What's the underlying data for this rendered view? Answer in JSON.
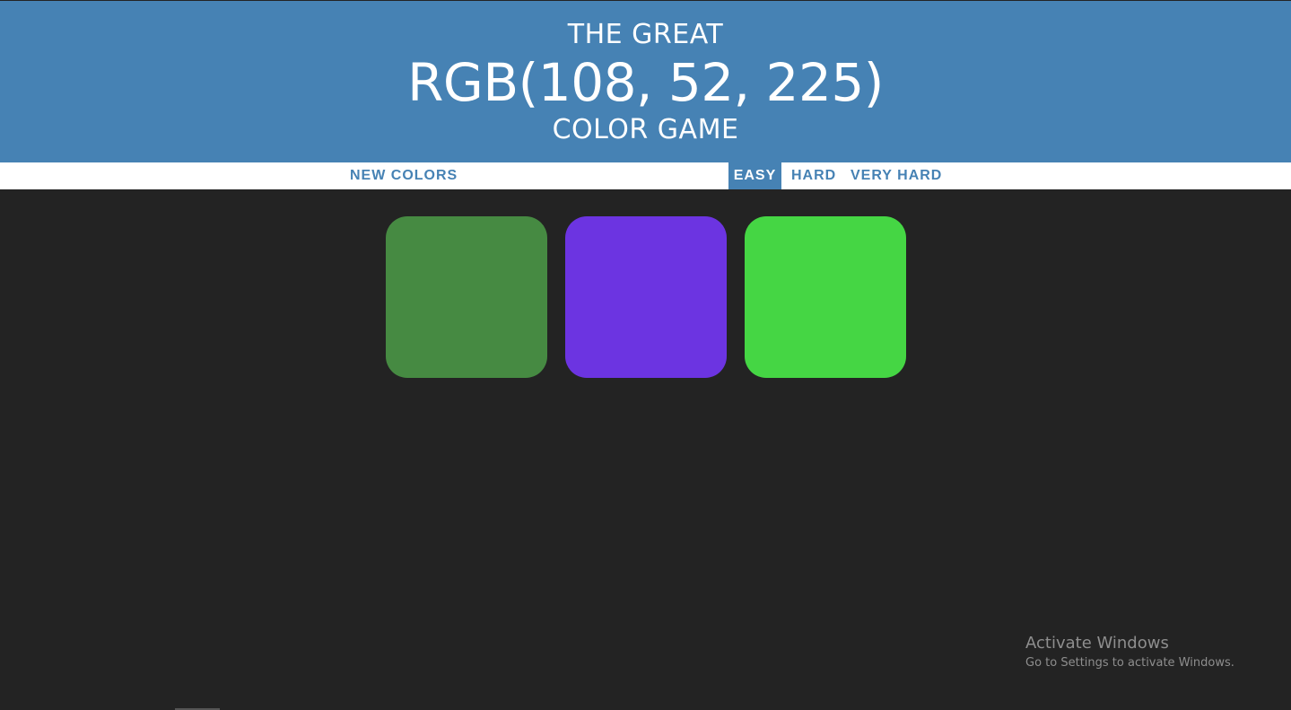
{
  "header": {
    "title_top": "THE GREAT",
    "target_rgb": "RGB(108, 52, 225)",
    "title_bottom": "COLOR GAME",
    "background_color": "#4682b4"
  },
  "controls": {
    "new_colors_label": "NEW COLORS",
    "message": "",
    "modes": [
      {
        "label": "EASY",
        "selected": true
      },
      {
        "label": "HARD",
        "selected": false
      },
      {
        "label": "VERY HARD",
        "selected": false
      }
    ]
  },
  "squares": [
    {
      "color": "#468a42"
    },
    {
      "color": "#6c34e1"
    },
    {
      "color": "#45d644"
    }
  ],
  "page": {
    "background_color": "#232323"
  },
  "watermark": {
    "title": "Activate Windows",
    "subtitle": "Go to Settings to activate Windows."
  }
}
